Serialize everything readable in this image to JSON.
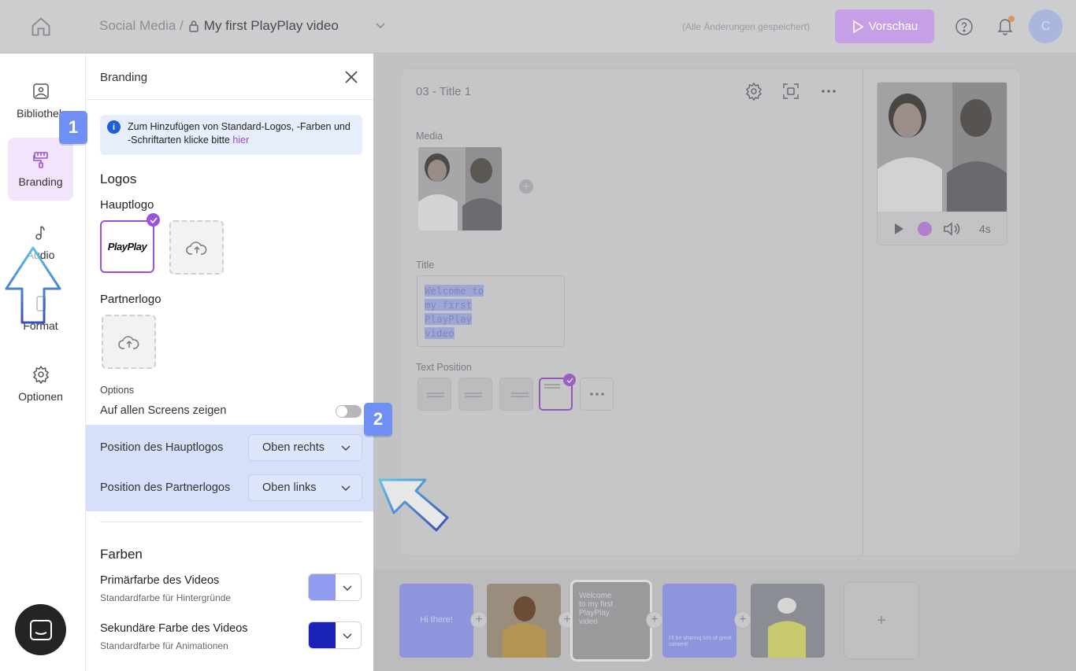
{
  "header": {
    "breadcrumb_parent": "Social Media /",
    "document_title": "My first PlayPlay video",
    "saved_status": "(Alle Änderungen gespeichert)",
    "preview_label": "Vorschau",
    "avatar_initial": "C"
  },
  "sidebar": {
    "items": [
      {
        "label": "Bibliothek",
        "icon": "image-library-icon"
      },
      {
        "label": "Branding",
        "icon": "paint-roller-icon",
        "active": true
      },
      {
        "label": "Audio",
        "icon": "music-note-icon"
      },
      {
        "label": "Format",
        "icon": "format-icon"
      },
      {
        "label": "Optionen",
        "icon": "gear-icon"
      }
    ]
  },
  "panel": {
    "title": "Branding",
    "info_text": "Zum Hinzufügen von Standard-Logos, -Farben und -Schriftarten klicke bitte",
    "info_link": "hier",
    "logos_heading": "Logos",
    "main_logo_label": "Hauptlogo",
    "main_logo_text": "PlayPlay",
    "partner_logo_label": "Partnerlogo",
    "options_label": "Options",
    "show_all_screens_label": "Auf allen Screens zeigen",
    "show_all_screens_on": false,
    "main_logo_position_label": "Position des Hauptlogos",
    "main_logo_position_value": "Oben rechts",
    "partner_logo_position_label": "Position des Partnerlogos",
    "partner_logo_position_value": "Oben links",
    "colors_heading": "Farben",
    "primary_color_title": "Primärfarbe des Videos",
    "primary_color_sub": "Standardfarbe für Hintergründe",
    "primary_color": "#8f9cf0",
    "secondary_color_title": "Sekundäre Farbe des Videos",
    "secondary_color_sub": "Standardfarbe für Animationen",
    "secondary_color": "#1a22b8"
  },
  "editor": {
    "slide_title": "03 - Title 1",
    "media_label": "Media",
    "title_label": "Title",
    "title_lines": [
      "Welcome to",
      "my first",
      "PlayPlay",
      "video"
    ],
    "text_position_label": "Text Position",
    "preview_duration": "4s"
  },
  "timeline": {
    "slides": [
      {
        "caption": "Hi there!",
        "color": "#8e95dc"
      },
      {
        "caption": "",
        "color": "#9a8a7a"
      },
      {
        "caption": "Welcome to my first PlayPlay video",
        "color": "#9a9a9a"
      },
      {
        "caption": "I’ll be sharing lots of great content!",
        "color": "#8e95dc"
      },
      {
        "caption": "",
        "color": "#8a8e94"
      }
    ]
  },
  "tutorial": {
    "step1": "1",
    "step2": "2"
  }
}
